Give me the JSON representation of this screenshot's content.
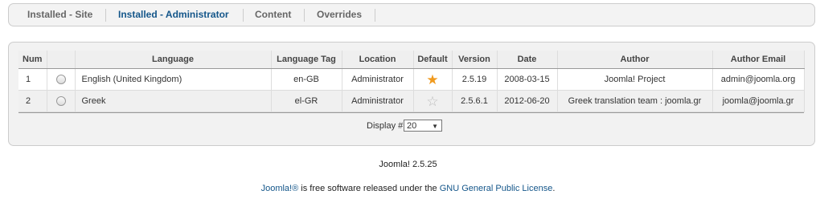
{
  "tabs": [
    {
      "label": "Installed - Site",
      "active": false
    },
    {
      "label": "Installed - Administrator",
      "active": true
    },
    {
      "label": "Content",
      "active": false
    },
    {
      "label": "Overrides",
      "active": false
    }
  ],
  "table": {
    "headers": [
      "Num",
      "",
      "Language",
      "Language Tag",
      "Location",
      "Default",
      "Version",
      "Date",
      "Author",
      "Author Email"
    ],
    "rows": [
      {
        "num": "1",
        "language": "English (United Kingdom)",
        "tag": "en-GB",
        "location": "Administrator",
        "default": true,
        "version": "2.5.19",
        "date": "2008-03-15",
        "author": "Joomla! Project",
        "email": "admin@joomla.org"
      },
      {
        "num": "2",
        "language": "Greek",
        "tag": "el-GR",
        "location": "Administrator",
        "default": false,
        "version": "2.5.6.1",
        "date": "2012-06-20",
        "author": "Greek translation team : joomla.gr",
        "email": "joomla@joomla.gr"
      }
    ]
  },
  "pagination": {
    "label": "Display #",
    "value": "20"
  },
  "footer": {
    "version": "Joomla! 2.5.25",
    "joomla_link": "Joomla!®",
    "license_text": " is free software released under the ",
    "license_link": "GNU General Public License",
    "end": "."
  },
  "colors": {
    "link": "#14568a",
    "star_default": "#f09a1e",
    "star_off": "#bbbbbb"
  }
}
